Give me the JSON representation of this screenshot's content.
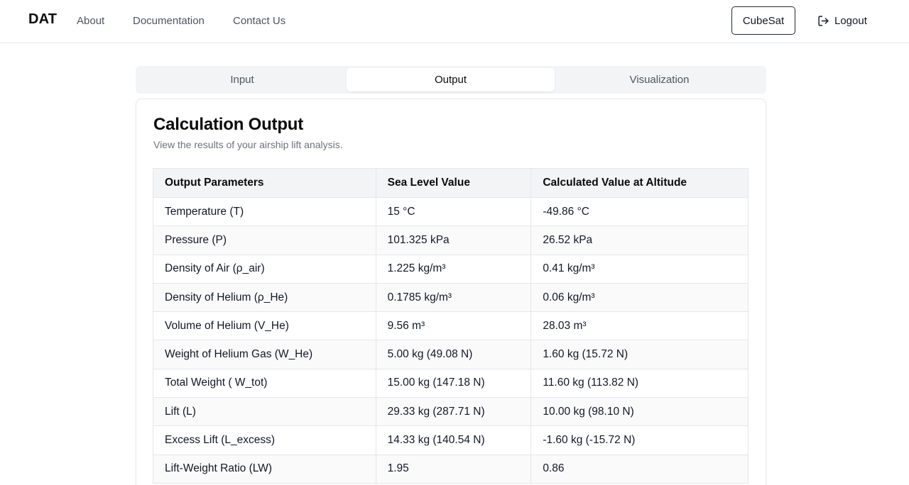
{
  "header": {
    "brand": "DAT",
    "nav": [
      "About",
      "Documentation",
      "Contact Us"
    ],
    "cubesat_label": "CubeSat",
    "logout_label": "Logout",
    "logout_icon": "logout-icon"
  },
  "tabs": {
    "items": [
      "Input",
      "Output",
      "Visualization"
    ],
    "active": "Output"
  },
  "card": {
    "title": "Calculation Output",
    "subtitle": "View the results of your airship lift analysis."
  },
  "table": {
    "headers": [
      "Output Parameters",
      "Sea Level Value",
      "Calculated Value at Altitude"
    ],
    "rows": [
      [
        "Temperature (T)",
        "15 °C",
        "-49.86 °C"
      ],
      [
        "Pressure (P)",
        "101.325 kPa",
        "26.52 kPa"
      ],
      [
        "Density of Air (ρ_air)",
        "1.225 kg/m³",
        "0.41 kg/m³"
      ],
      [
        "Density of Helium (ρ_He)",
        "0.1785 kg/m³",
        "0.06 kg/m³"
      ],
      [
        "Volume of Helium (V_He)",
        "9.56 m³",
        "28.03 m³"
      ],
      [
        "Weight of Helium Gas (W_He)",
        "5.00 kg (49.08 N)",
        "1.60 kg (15.72 N)"
      ],
      [
        "Total Weight ( W_tot)",
        "15.00 kg (147.18 N)",
        "11.60 kg (113.82 N)"
      ],
      [
        "Lift (L)",
        "29.33 kg (287.71 N)",
        "10.00 kg (98.10 N)"
      ],
      [
        "Excess Lift (L_excess)",
        "14.33 kg (140.54 N)",
        "-1.60 kg (-15.72 N)"
      ],
      [
        "Lift-Weight Ratio (LW)",
        "1.95",
        "0.86"
      ]
    ]
  }
}
